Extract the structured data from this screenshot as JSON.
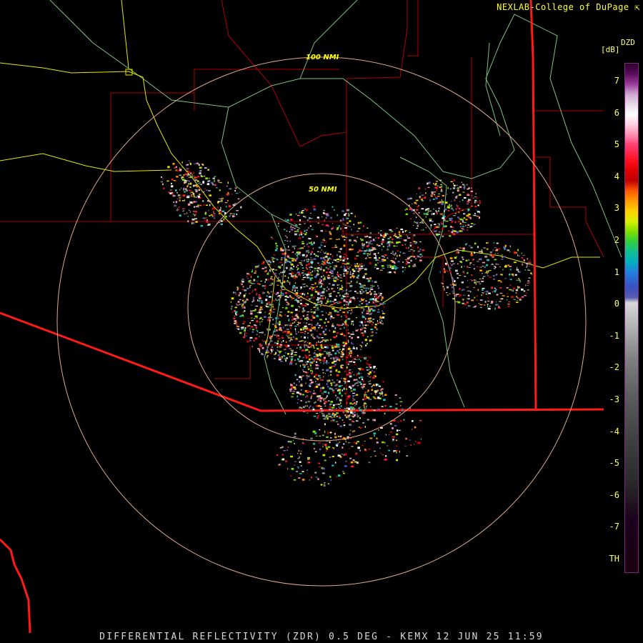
{
  "header": {
    "credit": "NEXLAB-College of DuPage ⇱"
  },
  "footer": {
    "caption": "DIFFERENTIAL REFLECTIVITY (ZDR) 0.5 DEG - KEMX 12 JUN 25 11:59"
  },
  "range_rings": [
    {
      "label": "50 NMI"
    },
    {
      "label": "100 NMI"
    }
  ],
  "colorbar": {
    "code": "DZD",
    "unit": "[dB]",
    "ticks": [
      "7",
      "6",
      "5",
      "4",
      "3",
      "2",
      "1",
      "0",
      "-1",
      "-2",
      "-3",
      "-4",
      "-5",
      "-6",
      "-7",
      "TH"
    ]
  },
  "colors": {
    "state_border": "#ff1a1a",
    "county_lines": "#b00000",
    "highways": "#e8e800",
    "rivers": "#7ac47a",
    "range_rings": "#e0a888",
    "label_text": "#ffff33"
  },
  "icons": {
    "link_icon": "external-link-icon"
  }
}
